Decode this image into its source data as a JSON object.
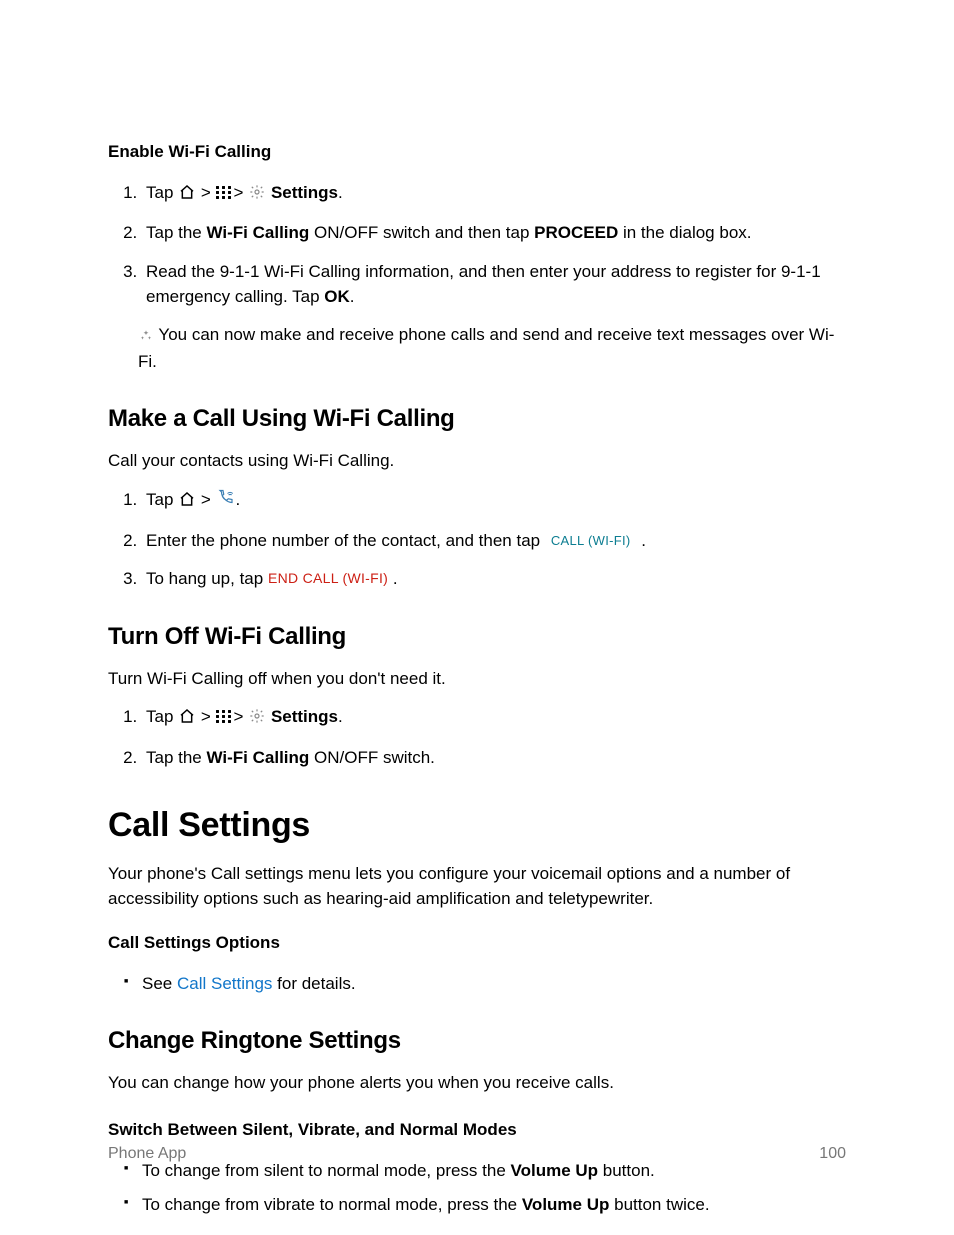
{
  "s1": {
    "title": "Enable Wi-Fi Calling",
    "step1_a": "Tap",
    "step1_b": " >",
    "step1_c": "> ",
    "step1_d": "Settings",
    "step1_e": ".",
    "step2_a": "Tap the ",
    "step2_b": "Wi-Fi Calling",
    "step2_c": " ON/OFF switch and then tap ",
    "step2_d": "PROCEED",
    "step2_e": " in the dialog box.",
    "step3_a": "Read the 9-1-1 Wi-Fi Calling information, and then enter your address to register for 9-1-1 emergency calling. Tap ",
    "step3_b": "OK",
    "step3_c": ".",
    "note": " You can now make and receive phone calls and send and receive text messages over Wi-Fi."
  },
  "s2": {
    "title": "Make a Call Using Wi-Fi Calling",
    "intro": "Call your contacts using Wi-Fi Calling.",
    "step1_a": "Tap",
    "step1_b": " > ",
    "step1_c": ".",
    "step2_a": "Enter the phone number of the contact, and then tap ",
    "step2_btn": "CALL (WI-FI)",
    "step2_c": ".",
    "step3_a": "To hang up, tap ",
    "step3_btn": "END CALL (WI-FI)",
    "step3_c": "."
  },
  "s3": {
    "title": "Turn Off Wi-Fi Calling",
    "intro": "Turn Wi-Fi Calling off when you don't need it.",
    "step1_a": "Tap",
    "step1_b": " >",
    "step1_c": "> ",
    "step1_d": "Settings",
    "step1_e": ".",
    "step2_a": "Tap the ",
    "step2_b": "Wi-Fi Calling",
    "step2_c": " ON/OFF switch."
  },
  "s4": {
    "title": "Call Settings",
    "intro": "Your phone's Call settings menu lets you configure your voicemail options and a number of accessibility options such as hearing-aid amplification and teletypewriter.",
    "sub_title": "Call Settings Options",
    "bullet_a": "See ",
    "bullet_link": "Call Settings",
    "bullet_c": " for details."
  },
  "s5": {
    "title": "Change Ringtone Settings",
    "intro": "You can change how your phone alerts you when you receive calls.",
    "sub_title": "Switch Between Silent, Vibrate, and Normal Modes",
    "b1_a": "To change from silent to normal mode, press the ",
    "b1_b": "Volume Up",
    "b1_c": " button.",
    "b2_a": "To change from vibrate to normal mode, press the ",
    "b2_b": "Volume Up",
    "b2_c": " button twice."
  },
  "footer": {
    "left": "Phone App",
    "right": "100"
  }
}
